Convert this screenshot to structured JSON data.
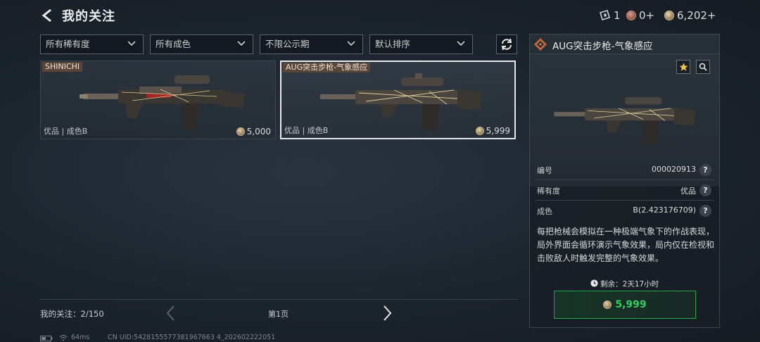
{
  "header": {
    "title": "我的关注",
    "ticket_count": "1",
    "red_coin": "0+",
    "gold_coin": "6,202+"
  },
  "filters": [
    {
      "label": "所有稀有度"
    },
    {
      "label": "所有成色"
    },
    {
      "label": "不限公示期"
    },
    {
      "label": "默认排序"
    }
  ],
  "cards": [
    {
      "name": "SHINICHI",
      "meta": "优品 | 成色B",
      "price": "5,000"
    },
    {
      "name": "AUG突击步枪-气象感应",
      "meta": "优品 | 成色B",
      "price": "5,999"
    }
  ],
  "footer": {
    "follow_count": "我的关注：2/150",
    "page_label": "第1页",
    "ping": "64ms",
    "uid": "CN UID:5428155577381967663 4_202602222051"
  },
  "detail": {
    "title": "AUG突击步枪-气象感应",
    "rows": [
      {
        "label": "编号",
        "value": "000020913"
      },
      {
        "label": "稀有度",
        "value": "优品"
      },
      {
        "label": "成色",
        "value": "B(2.423176709)"
      }
    ],
    "description": "每把枪械会模拟在一种极端气象下的作战表现，局外界面会循环演示气象效果，局内仅在检视和击败敌人时触发完整的气象效果。",
    "timer": "剩余：2天17小时",
    "price": "5,999"
  },
  "colors": {
    "buy_green": "#2fd060",
    "selected_border": "#e6e9ec"
  }
}
